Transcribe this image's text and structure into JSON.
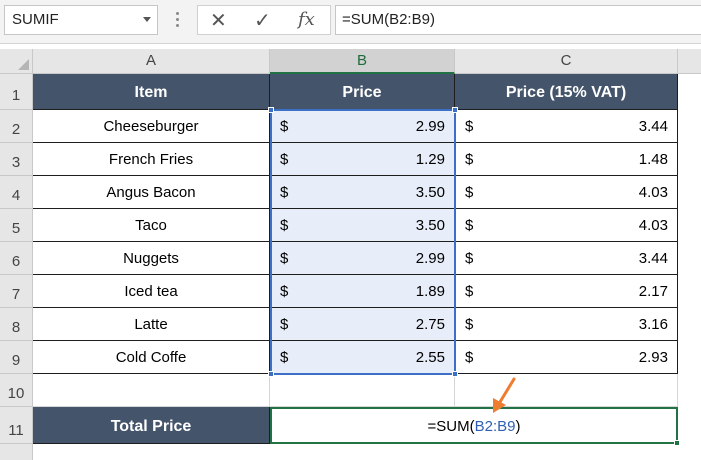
{
  "formula_bar": {
    "name_box": "SUMIF",
    "cancel_icon": "✕",
    "enter_icon": "✓",
    "fx_label": "fx",
    "formula": "=SUM(B2:B9)"
  },
  "columns": [
    "A",
    "B",
    "C"
  ],
  "rows": [
    "1",
    "2",
    "3",
    "4",
    "5",
    "6",
    "7",
    "8",
    "9",
    "10",
    "11"
  ],
  "table": {
    "headers": [
      "Item",
      "Price",
      "Price (15% VAT)"
    ],
    "currency_symbol": "$",
    "items": [
      {
        "item": "Cheeseburger",
        "price": "2.99",
        "vat": "3.44"
      },
      {
        "item": "French Fries",
        "price": "1.29",
        "vat": "1.48"
      },
      {
        "item": "Angus Bacon",
        "price": "3.50",
        "vat": "4.03"
      },
      {
        "item": "Taco",
        "price": "3.50",
        "vat": "4.03"
      },
      {
        "item": "Nuggets",
        "price": "2.99",
        "vat": "3.44"
      },
      {
        "item": "Iced tea",
        "price": "1.89",
        "vat": "2.17"
      },
      {
        "item": "Latte",
        "price": "2.75",
        "vat": "3.16"
      },
      {
        "item": "Cold Coffe",
        "price": "2.55",
        "vat": "2.93"
      }
    ]
  },
  "total": {
    "label": "Total Price",
    "formula_prefix": "=SUM(",
    "formula_ref": "B2:B9",
    "formula_suffix": ")"
  },
  "colors": {
    "header_fill": "#44546a",
    "range_highlight": "#3c6fc6",
    "active_cell_border": "#217346",
    "arrow": "#ed7d31"
  }
}
